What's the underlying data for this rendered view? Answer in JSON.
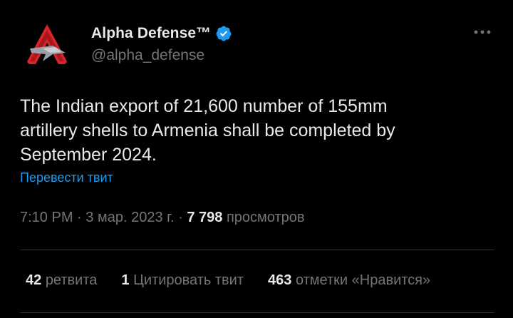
{
  "author": {
    "display_name": "Alpha Defense™",
    "handle": "@alpha_defense",
    "verified": true,
    "avatar_icon": "alpha-defense-logo-icon"
  },
  "menu": {
    "icon": "more-options-icon"
  },
  "tweet": {
    "text": "The Indian export of 21,600 number of 155mm\nartillery shells to Armenia shall be completed by\nSeptember 2024.",
    "translate_label": "Перевести твит"
  },
  "meta": {
    "time": "7:10 PM",
    "separator": "·",
    "date": "3 мар. 2023 г.",
    "views_count": "7 798",
    "views_label": "просмотров"
  },
  "stats": {
    "retweets": {
      "count": "42",
      "label": "ретвита"
    },
    "quotes": {
      "count": "1",
      "label": "Цитировать твит"
    },
    "likes": {
      "count": "463",
      "label": "отметки «Нравится»"
    }
  },
  "colors": {
    "background": "#000000",
    "text_primary": "#e7e9ea",
    "text_secondary": "#71767b",
    "link": "#1d9bf0",
    "verified": "#1d9bf0",
    "logo_red": "#d7252b",
    "divider": "#2f3336"
  }
}
